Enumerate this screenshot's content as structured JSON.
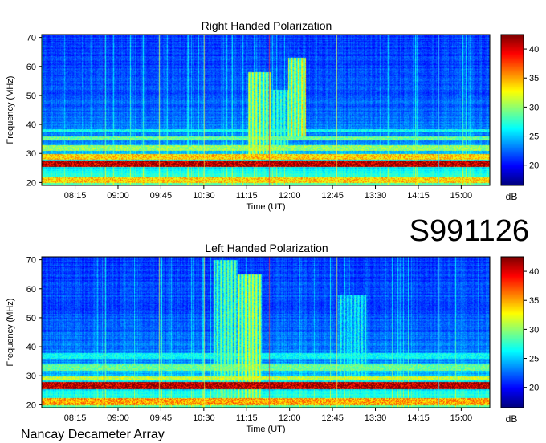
{
  "figure": {
    "id_label": "S991126",
    "footer": "Nancay Decameter Array"
  },
  "chart_data": [
    {
      "type": "heatmap",
      "title": "Right Handed Polarization",
      "xlabel": "Time (UT)",
      "ylabel": "Frequency (MHz)",
      "x_tick_labels": [
        "08:15",
        "09:00",
        "09:45",
        "10:30",
        "11:15",
        "12:00",
        "12:45",
        "13:30",
        "14:15",
        "15:00"
      ],
      "x_tick_minutes": [
        495,
        540,
        585,
        630,
        675,
        720,
        765,
        810,
        855,
        900
      ],
      "xlim_minutes": [
        460,
        930
      ],
      "y_ticks": [
        20,
        30,
        40,
        50,
        60,
        70
      ],
      "ylim": [
        19,
        71
      ],
      "colorbar": {
        "label": "dB",
        "ticks": [
          20,
          25,
          30,
          35,
          40
        ],
        "range": [
          16.5,
          42.5
        ]
      },
      "features": {
        "interference_bands_mhz": [
          [
            20,
            22,
            0.7
          ],
          [
            25.5,
            27.8,
            1.0
          ],
          [
            28,
            30,
            0.7
          ],
          [
            31,
            33,
            0.55
          ],
          [
            34.5,
            36,
            0.5
          ],
          [
            37.5,
            38.5,
            0.4
          ]
        ],
        "bursts": [
          {
            "t": [
              676,
              700
            ],
            "f": [
              28,
              58
            ],
            "level": 0.55
          },
          {
            "t": [
              700,
              718
            ],
            "f": [
              30,
              52
            ],
            "level": 0.4
          },
          {
            "t": [
              718,
              737
            ],
            "f": [
              36,
              63
            ],
            "level": 0.6
          }
        ],
        "vertical_lines_minutes": [
          {
            "t": 525,
            "color": "#ff3030"
          },
          {
            "t": 583,
            "color": "#ffee40"
          },
          {
            "t": 630,
            "color": "#ffee40"
          },
          {
            "t": 698,
            "color": "#ff3030"
          },
          {
            "t": 769,
            "color": "#ffee40"
          },
          {
            "t": 876,
            "color": "#40e0ff"
          }
        ]
      }
    },
    {
      "type": "heatmap",
      "title": "Left Handed Polarization",
      "xlabel": "Time (UT)",
      "ylabel": "Frequency (MHz)",
      "x_tick_labels": [
        "08:15",
        "09:00",
        "09:45",
        "10:30",
        "11:15",
        "12:00",
        "12:45",
        "13:30",
        "14:15",
        "15:00"
      ],
      "x_tick_minutes": [
        495,
        540,
        585,
        630,
        675,
        720,
        765,
        810,
        855,
        900
      ],
      "xlim_minutes": [
        460,
        930
      ],
      "y_ticks": [
        20,
        30,
        40,
        50,
        60,
        70
      ],
      "ylim": [
        19,
        71
      ],
      "colorbar": {
        "label": "dB",
        "ticks": [
          20,
          25,
          30,
          35,
          40
        ],
        "range": [
          16.5,
          42.5
        ]
      },
      "features": {
        "interference_bands_mhz": [
          [
            20,
            22.5,
            0.75
          ],
          [
            25.5,
            28,
            1.0
          ],
          [
            28.5,
            30,
            0.6
          ],
          [
            32,
            34,
            0.5
          ],
          [
            36,
            38,
            0.4
          ]
        ],
        "bursts": [
          {
            "t": [
              640,
              665
            ],
            "f": [
              22,
              70
            ],
            "level": 0.45
          },
          {
            "t": [
              665,
              690
            ],
            "f": [
              20,
              65
            ],
            "level": 0.55
          },
          {
            "t": [
              770,
              800
            ],
            "f": [
              20,
              58
            ],
            "level": 0.35
          }
        ],
        "vertical_lines_minutes": [
          {
            "t": 525,
            "color": "#ff3030"
          },
          {
            "t": 583,
            "color": "#ffee40"
          },
          {
            "t": 630,
            "color": "#ffee40"
          },
          {
            "t": 698,
            "color": "#ff3030"
          },
          {
            "t": 769,
            "color": "#ffee40"
          },
          {
            "t": 876,
            "color": "#40e0ff"
          }
        ]
      }
    }
  ]
}
